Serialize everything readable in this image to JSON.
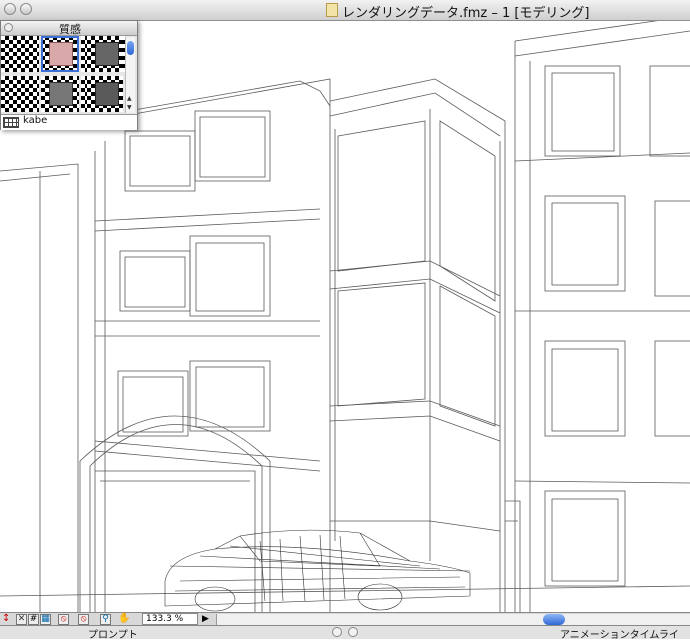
{
  "window": {
    "title": "レンダリングデータ.fmz – 1 [モデリング]"
  },
  "material_palette": {
    "title": "質感",
    "selected_material_name": "kabe",
    "swatches": [
      {
        "name": "checker-sphere",
        "color": "#444444"
      },
      {
        "name": "pink-cube",
        "color": "#d9a8a8"
      },
      {
        "name": "yellow-cube",
        "color": "#e8e27a"
      },
      {
        "name": "dark-cube",
        "color": "#666666"
      },
      {
        "name": "checker-blank",
        "color": "#ffffff"
      },
      {
        "name": "textured-cube",
        "color": "#777777"
      },
      {
        "name": "gray-cube",
        "color": "#8a8a8a"
      },
      {
        "name": "dark-gray-cube",
        "color": "#5a5a5a"
      }
    ]
  },
  "toolbar": {
    "zoom_label": "133.3 %"
  },
  "status": {
    "prompt_label": "プロンプト",
    "animation_label": "アニメーションタイムライ"
  },
  "colors": {
    "accent": "#2f67d5",
    "wireframe": "#5a5a5a"
  }
}
